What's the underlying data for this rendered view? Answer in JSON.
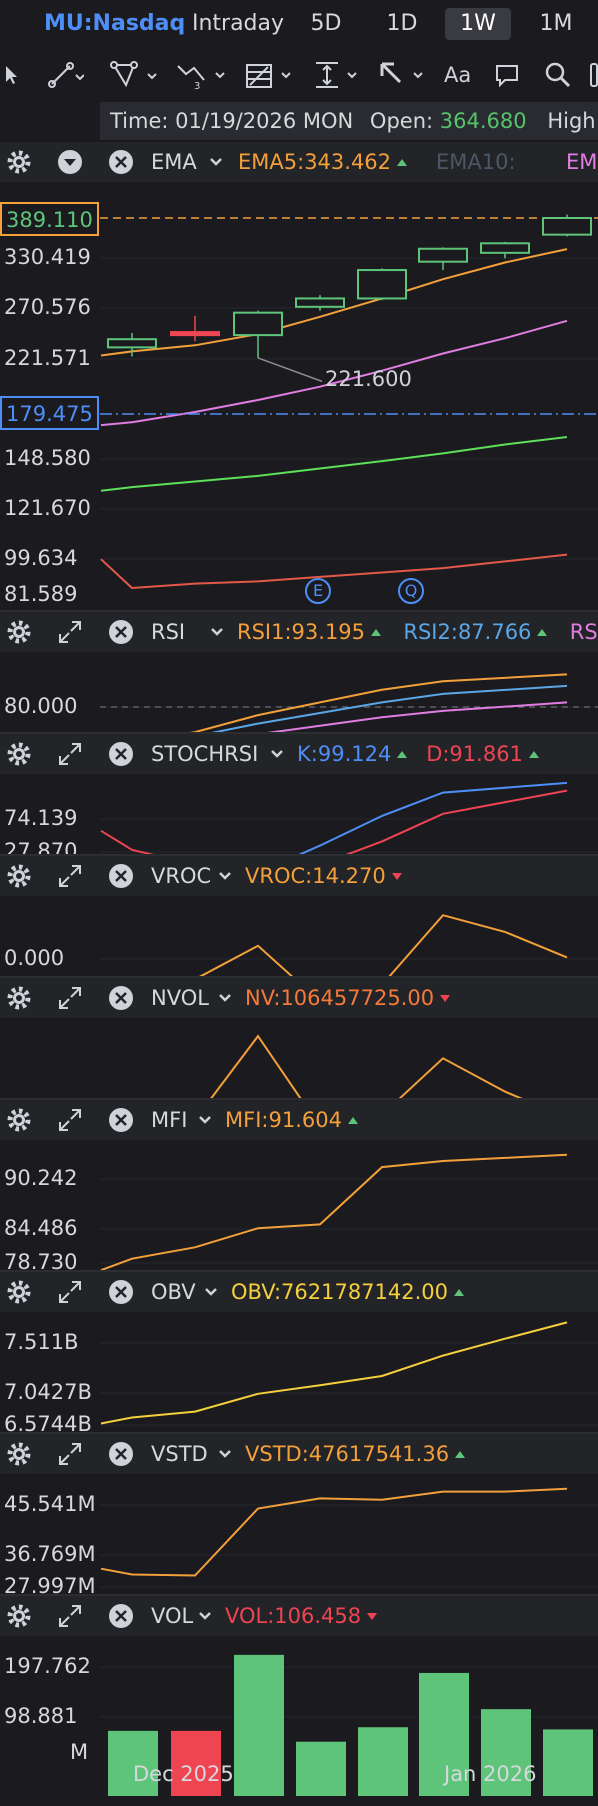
{
  "symbol": "MU:Nasdaq",
  "range_tabs": [
    "Intraday",
    "5D",
    "1D",
    "1W",
    "1M"
  ],
  "active_tab": "1W",
  "toolbar_icons": [
    "pointer-icon",
    "line-tool-icon",
    "channel-tool-icon",
    "wave-tool-icon",
    "fib-tool-icon",
    "measure-tool-icon",
    "arrow-tool-icon",
    "text-tool-icon",
    "comment-icon",
    "search-icon"
  ],
  "toolbar_text_label": "Aa",
  "info": {
    "time_label": "Time:",
    "time_value": "01/19/2026 MON",
    "open_label": "Open:",
    "open_value": "364.680",
    "high_label": "High:"
  },
  "colors": {
    "background": "#1b1b1f",
    "up": "#5ec47a",
    "down": "#ef4452",
    "ema5": "#f4a03a",
    "ema10": "#5d6b7a",
    "ema20": "#e17de0",
    "ema60": "#5ee05a",
    "ema120": "#e4584a",
    "accent_blue": "#4d8ef7",
    "yellow": "#f5cf3c"
  },
  "ema": {
    "name": "EMA",
    "ema5_label": "EMA5:343.462",
    "ema10_label": "EMA10:",
    "ema20_label": "EM",
    "current_price": "389.110",
    "crosshair_price": "179.475",
    "low_marker": "221.600",
    "y_ticks": [
      "330.419",
      "270.576",
      "221.571",
      "148.580",
      "121.670",
      "99.634",
      "81.589"
    ],
    "event_markers": [
      "E",
      "Q"
    ]
  },
  "panels": [
    {
      "name": "RSI",
      "values": [
        {
          "text": "RSI1:93.195",
          "color": "#f4a03a",
          "dir": "up"
        },
        {
          "text": "RSI2:87.766",
          "color": "#5aa7e8",
          "dir": "up"
        },
        {
          "text": "RS",
          "color": "#e17de0",
          "dir": ""
        }
      ],
      "y_ticks": [
        "80.000"
      ]
    },
    {
      "name": "STOCHRSI",
      "values": [
        {
          "text": "K:99.124",
          "color": "#4d8ef7",
          "dir": "up"
        },
        {
          "text": "D:91.861",
          "color": "#ef4452",
          "dir": "up"
        }
      ],
      "y_ticks": [
        "74.139",
        "27.870"
      ]
    },
    {
      "name": "VROC",
      "values": [
        {
          "text": "VROC:14.270",
          "color": "#f4a03a",
          "dir": "down"
        }
      ],
      "y_ticks": [
        "0.000"
      ]
    },
    {
      "name": "NVOL",
      "values": [
        {
          "text": "NV:106457725.00",
          "color": "#f47a3a",
          "dir": "down"
        }
      ],
      "y_ticks": []
    },
    {
      "name": "MFI",
      "values": [
        {
          "text": "MFI:91.604",
          "color": "#f4a03a",
          "dir": "up"
        }
      ],
      "y_ticks": [
        "90.242",
        "84.486",
        "78.730"
      ]
    },
    {
      "name": "OBV",
      "values": [
        {
          "text": "OBV:7621787142.00",
          "color": "#f5cf3c",
          "dir": "up"
        }
      ],
      "y_ticks": [
        "7.511B",
        "7.0427B",
        "6.5744B"
      ]
    },
    {
      "name": "VSTD",
      "values": [
        {
          "text": "VSTD:47617541.36",
          "color": "#f4a03a",
          "dir": "up"
        }
      ],
      "y_ticks": [
        "45.541M",
        "36.769M",
        "27.997M"
      ]
    },
    {
      "name": "VOL",
      "values": [
        {
          "text": "VOL:106.458",
          "color": "#ef4452",
          "dir": "down"
        }
      ],
      "y_ticks": [
        "197.762",
        "98.881",
        "M"
      ]
    }
  ],
  "x_axis": [
    "Dec 2025",
    "Jan 2026"
  ],
  "chart_data": {
    "type": "candlestick",
    "series_count": 8,
    "candles": [
      {
        "open": 232,
        "close": 240,
        "high": 246,
        "low": 223,
        "up": true
      },
      {
        "open": 247,
        "close": 244,
        "high": 263,
        "low": 238,
        "up": false
      },
      {
        "open": 244,
        "close": 266,
        "high": 268,
        "low": 221.6,
        "up": true
      },
      {
        "open": 272,
        "close": 282,
        "high": 286,
        "low": 268,
        "up": true
      },
      {
        "open": 282,
        "close": 316,
        "high": 318,
        "low": 280,
        "up": true
      },
      {
        "open": 326,
        "close": 344,
        "high": 346,
        "low": 316,
        "up": true
      },
      {
        "open": 338,
        "close": 352,
        "high": 354,
        "low": 330,
        "up": true
      },
      {
        "open": 364.68,
        "close": 389.11,
        "high": 394,
        "low": 362,
        "up": true
      }
    ],
    "ema5": [
      228,
      234,
      245,
      262,
      282,
      305,
      325,
      343.462
    ],
    "ema20": [
      174,
      181,
      190,
      200,
      212,
      226,
      241,
      258
    ],
    "ema60": [
      134,
      137,
      140,
      144,
      148,
      153,
      159,
      164
    ],
    "ema120": [
      87,
      89,
      90,
      92,
      94,
      96,
      99,
      102
    ],
    "rsi1": [
      60,
      61,
      66,
      74,
      80,
      86,
      90,
      93.195
    ],
    "rsi2": [
      62,
      62,
      64,
      70,
      75,
      80,
      84,
      87.766
    ],
    "rsi3": [
      58,
      58,
      61,
      65,
      69,
      73,
      76,
      80
    ],
    "stoch_k": [
      22,
      8,
      10,
      14,
      40,
      68,
      90,
      99.124
    ],
    "stoch_d": [
      54,
      36,
      22,
      12,
      22,
      44,
      70,
      91.861
    ],
    "vroc": [
      -20,
      -60,
      -25,
      35,
      -65,
      -35,
      90,
      60,
      14.27
    ],
    "nvol": [
      2,
      6,
      7,
      90,
      0,
      12,
      68,
      35,
      9
    ],
    "mfi": [
      76.5,
      78,
      79.5,
      82,
      82.5,
      90.0,
      90.8,
      91.2,
      91.604
    ],
    "obv": [
      6.43,
      6.5,
      6.57,
      6.78,
      6.88,
      6.99,
      7.23,
      7.43,
      7.622
    ],
    "vstd": [
      31.0,
      29.8,
      29.6,
      43.5,
      45.6,
      45.3,
      47.0,
      47.0,
      47.6
    ],
    "volume": [
      90,
      90,
      195,
      75,
      95,
      170,
      120,
      92
    ],
    "volume_up": [
      true,
      false,
      true,
      true,
      true,
      true,
      true,
      true
    ]
  }
}
